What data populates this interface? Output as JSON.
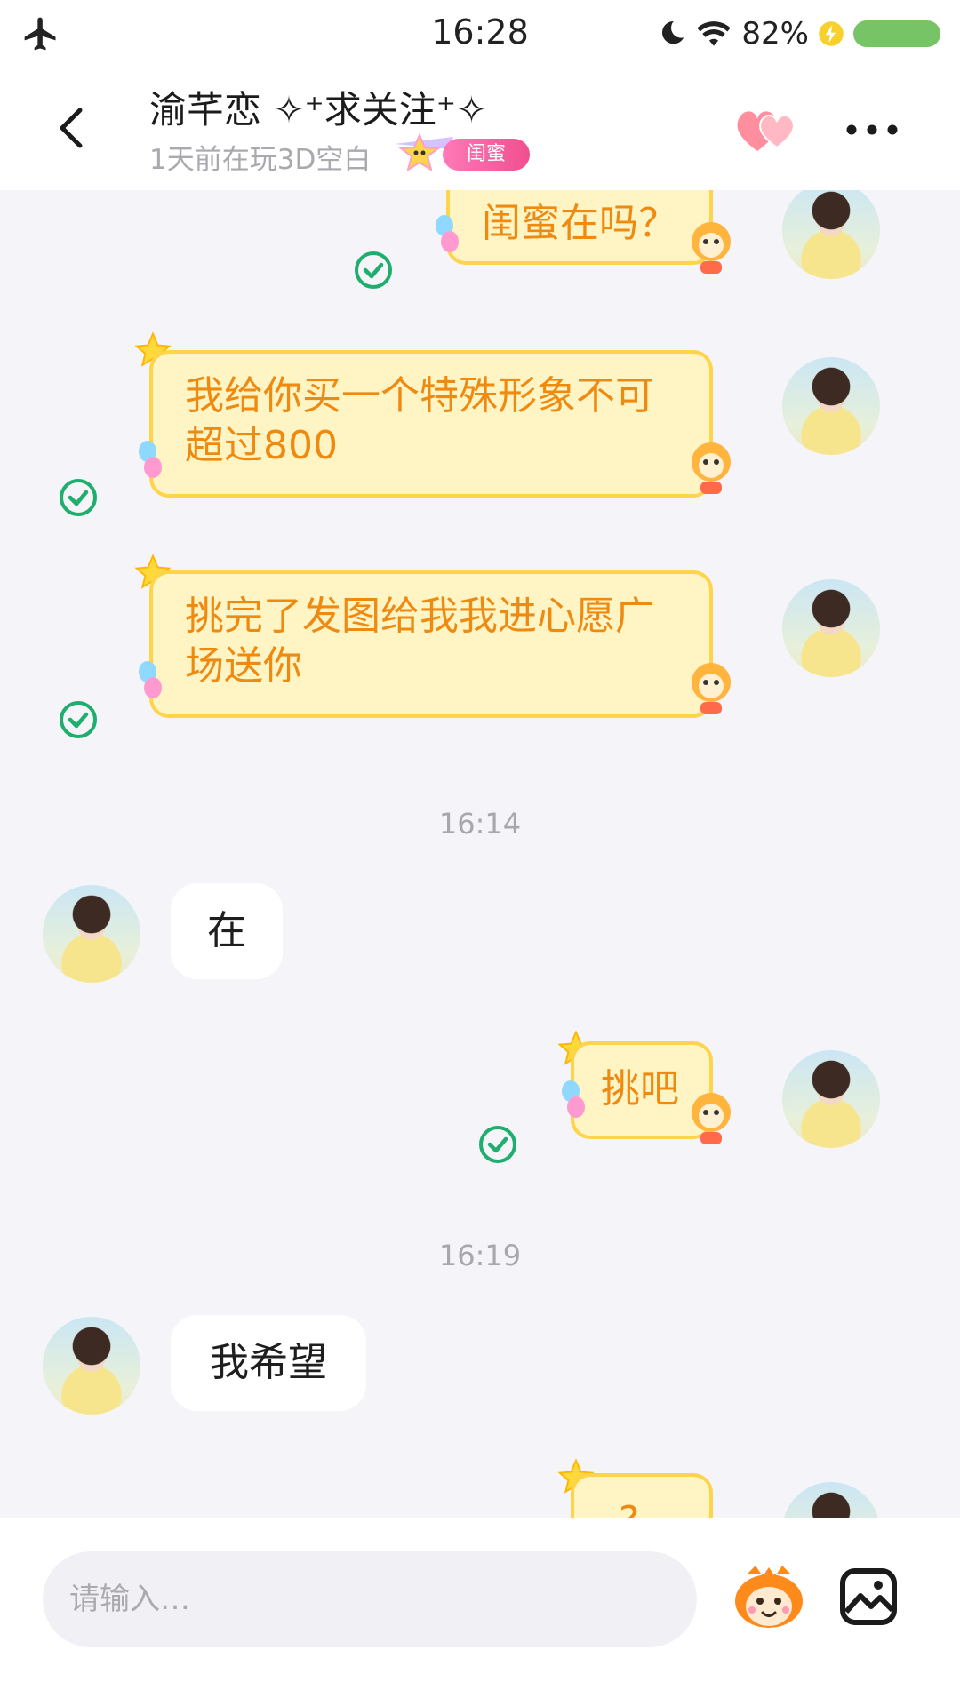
{
  "status_bar": {
    "time": "16:28",
    "battery_text": "82%"
  },
  "header": {
    "name": "渝芊恋 ✧⁺求关注⁺✧",
    "subtitle": "1天前在玩3D空白",
    "badge": "闺蜜"
  },
  "messages": [
    {
      "side": "right",
      "style": "sticker-bubble",
      "text": "闺蜜在吗？",
      "read": true
    },
    {
      "side": "right",
      "style": "sticker-bubble",
      "text": "我给你买一个特殊形象不可超过800",
      "read": true
    },
    {
      "side": "right",
      "style": "sticker-bubble",
      "text": "挑完了发图给我我进心愿广场送你",
      "read": true
    },
    {
      "type": "timestamp",
      "text": "16:14"
    },
    {
      "side": "left",
      "style": "plain",
      "text": "在"
    },
    {
      "side": "right",
      "style": "sticker-bubble",
      "text": "挑吧",
      "read": true
    },
    {
      "type": "timestamp",
      "text": "16:19"
    },
    {
      "side": "left",
      "style": "plain",
      "text": "我希望"
    },
    {
      "side": "right",
      "style": "sticker-bubble",
      "text": "?",
      "read": false
    }
  ],
  "input": {
    "placeholder": "请输入…"
  },
  "colors": {
    "bubble_fill": "#fff4c4",
    "bubble_border": "#ffd34a",
    "bubble_text": "#ef8a11",
    "check": "#1fae6e",
    "badge": "#f04f8f"
  },
  "icons": [
    "airplane-icon",
    "moon-icon",
    "wifi-icon",
    "lightning-icon",
    "back-arrow-icon",
    "hearts-icon",
    "more-icon",
    "check-icon",
    "emoji-face-icon",
    "image-icon"
  ]
}
